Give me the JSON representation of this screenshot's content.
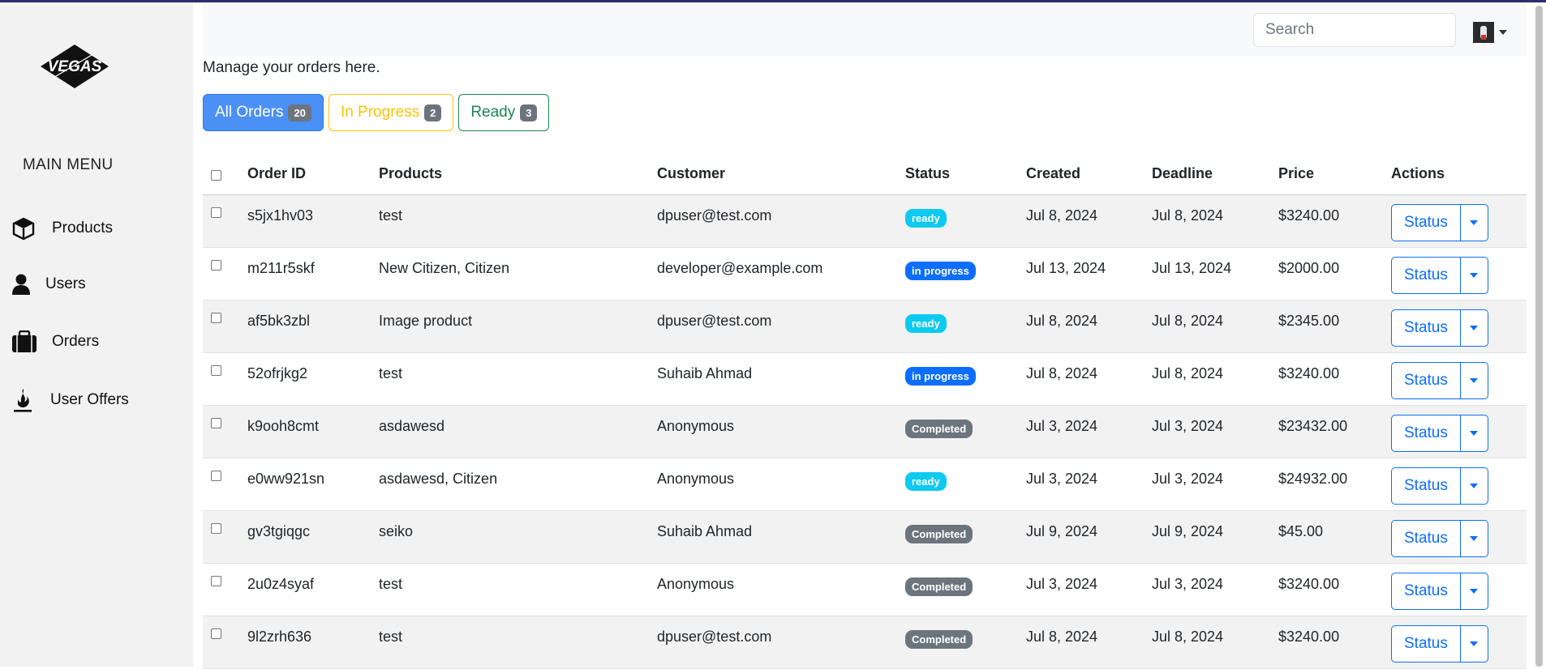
{
  "brand": {
    "logo_text": "VEGAS"
  },
  "sidebar": {
    "menu_title": "MAIN MENU",
    "items": [
      {
        "label": "Products",
        "icon": "box-icon"
      },
      {
        "label": "Users",
        "icon": "user-icon"
      },
      {
        "label": "Orders",
        "icon": "briefcase-icon"
      },
      {
        "label": "User Offers",
        "icon": "fire-icon"
      }
    ]
  },
  "header": {
    "search_placeholder": "Search"
  },
  "page": {
    "subtitle": "Manage your orders here."
  },
  "filters": [
    {
      "label": "All Orders",
      "count": "20"
    },
    {
      "label": "In Progress",
      "count": "2"
    },
    {
      "label": "Ready",
      "count": "3"
    }
  ],
  "table": {
    "columns": [
      "Order ID",
      "Products",
      "Customer",
      "Status",
      "Created",
      "Deadline",
      "Price",
      "Actions"
    ],
    "action_label": "Status",
    "status_colors": {
      "ready": "#0dcaf0",
      "in progress": "#0d6efd",
      "Completed": "#6c757d"
    },
    "rows": [
      {
        "id": "s5jx1hv03",
        "products": "test",
        "customer": "dpuser@test.com",
        "status": "ready",
        "created": "Jul 8, 2024",
        "deadline": "Jul 8, 2024",
        "price": "$3240.00"
      },
      {
        "id": "m211r5skf",
        "products": "New Citizen, Citizen",
        "customer": "developer@example.com",
        "status": "in progress",
        "created": "Jul 13, 2024",
        "deadline": "Jul 13, 2024",
        "price": "$2000.00"
      },
      {
        "id": "af5bk3zbl",
        "products": "Image product",
        "customer": "dpuser@test.com",
        "status": "ready",
        "created": "Jul 8, 2024",
        "deadline": "Jul 8, 2024",
        "price": "$2345.00"
      },
      {
        "id": "52ofrjkg2",
        "products": "test",
        "customer": "Suhaib Ahmad",
        "status": "in progress",
        "created": "Jul 8, 2024",
        "deadline": "Jul 8, 2024",
        "price": "$3240.00"
      },
      {
        "id": "k9ooh8cmt",
        "products": "asdawesd",
        "customer": "Anonymous",
        "status": "Completed",
        "created": "Jul 3, 2024",
        "deadline": "Jul 3, 2024",
        "price": "$23432.00"
      },
      {
        "id": "e0ww921sn",
        "products": "asdawesd, Citizen",
        "customer": "Anonymous",
        "status": "ready",
        "created": "Jul 3, 2024",
        "deadline": "Jul 3, 2024",
        "price": "$24932.00"
      },
      {
        "id": "gv3tgiqgc",
        "products": "seiko",
        "customer": "Suhaib Ahmad",
        "status": "Completed",
        "created": "Jul 9, 2024",
        "deadline": "Jul 9, 2024",
        "price": "$45.00"
      },
      {
        "id": "2u0z4syaf",
        "products": "test",
        "customer": "Anonymous",
        "status": "Completed",
        "created": "Jul 3, 2024",
        "deadline": "Jul 3, 2024",
        "price": "$3240.00"
      },
      {
        "id": "9l2zrh636",
        "products": "test",
        "customer": "dpuser@test.com",
        "status": "Completed",
        "created": "Jul 8, 2024",
        "deadline": "Jul 8, 2024",
        "price": "$3240.00"
      }
    ]
  }
}
